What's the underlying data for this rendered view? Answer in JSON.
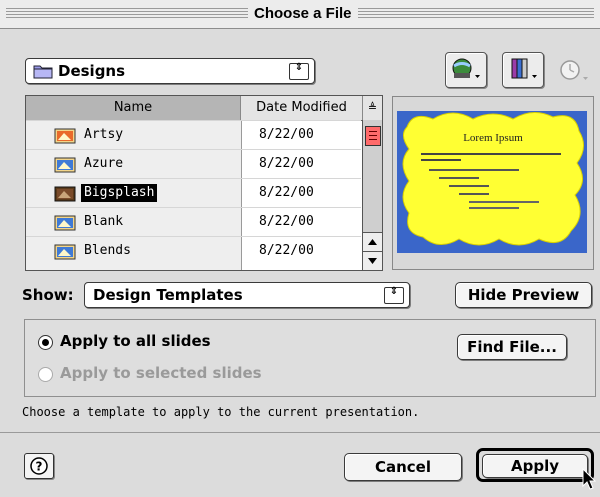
{
  "window": {
    "title": "Choose a File"
  },
  "folder_popup": {
    "selected": "Designs",
    "arrows": "⇕"
  },
  "file_list": {
    "headers": {
      "name": "Name",
      "date": "Date Modified",
      "sort": "≜"
    },
    "rows": [
      {
        "name": "Artsy",
        "date": "8/22/00",
        "selected": false
      },
      {
        "name": "Azure",
        "date": "8/22/00",
        "selected": false
      },
      {
        "name": "Bigsplash",
        "date": "8/22/00",
        "selected": true
      },
      {
        "name": "Blank",
        "date": "8/22/00",
        "selected": false
      },
      {
        "name": "Blends",
        "date": "8/22/00",
        "selected": false
      }
    ]
  },
  "preview": {
    "title": "Lorem Ipsum",
    "accent_colors": {
      "background": "#3a66c9",
      "blob": "#ffff33"
    }
  },
  "show": {
    "label": "Show:",
    "selected": "Design Templates",
    "arrows": "⇕"
  },
  "buttons": {
    "hide_preview": "Hide Preview",
    "find_file": "Find File...",
    "cancel": "Cancel",
    "apply": "Apply"
  },
  "apply_options": {
    "all": "Apply to all slides",
    "selected": "Apply to selected slides"
  },
  "status_text": "Choose a template to apply to the current presentation.",
  "icons": {
    "folder": "folder-icon",
    "globe": "globe-icon",
    "books": "favorites-icon",
    "clock": "clock-icon",
    "help": "help-icon"
  }
}
